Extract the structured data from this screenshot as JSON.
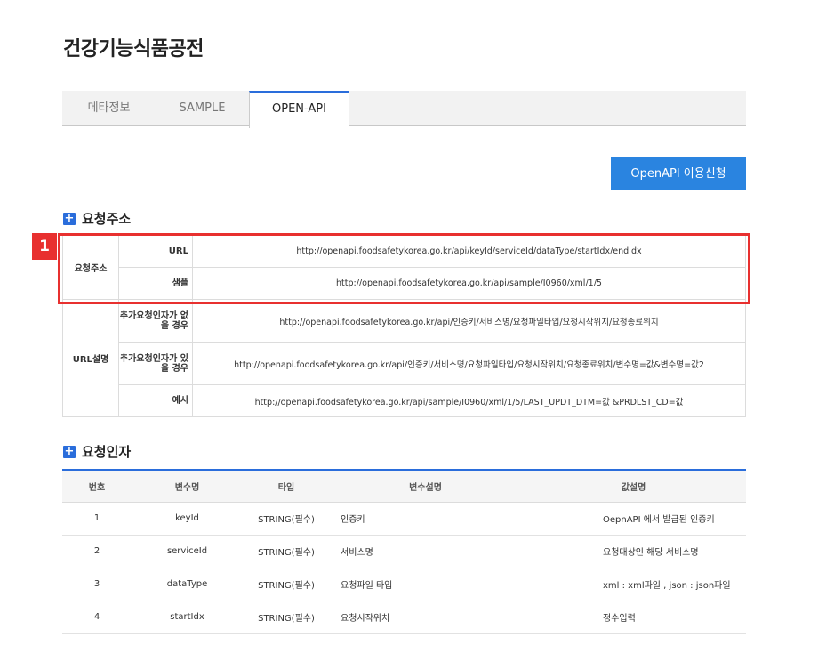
{
  "page": {
    "title": "건강기능식품공전"
  },
  "tabs": [
    {
      "label": "메타정보"
    },
    {
      "label": "SAMPLE"
    },
    {
      "label": "OPEN-API"
    }
  ],
  "apply_button": {
    "label": "OpenAPI 이용신청"
  },
  "marker": "1",
  "request_url_section": {
    "heading": "요청주소",
    "group_request": "요청주소",
    "group_url_desc": "URL설명",
    "rows": [
      {
        "label": "URL",
        "value": "http://openapi.foodsafetykorea.go.kr/api/keyId/serviceId/dataType/startIdx/endIdx"
      },
      {
        "label": "샘플",
        "value": "http://openapi.foodsafetykorea.go.kr/api/sample/I0960/xml/1/5"
      },
      {
        "label": "추가요청인자가 없을 경우",
        "value": "http://openapi.foodsafetykorea.go.kr/api/인증키/서비스명/요청파일타입/요청시작위치/요청종료위치"
      },
      {
        "label": "추가요청인자가 있을 경우",
        "value": "http://openapi.foodsafetykorea.go.kr/api/인증키/서비스명/요청파일타입/요청시작위치/요청종료위치/변수명=값&변수명=값2"
      },
      {
        "label": "예시",
        "value": "http://openapi.foodsafetykorea.go.kr/api/sample/I0960/xml/1/5/LAST_UPDT_DTM=값 &PRDLST_CD=값"
      }
    ]
  },
  "request_params_section": {
    "heading": "요청인자",
    "columns": [
      "번호",
      "변수명",
      "타입",
      "변수설명",
      "값설명"
    ],
    "rows": [
      [
        "1",
        "keyId",
        "STRING(필수)",
        "인증키",
        "OepnAPI 에서 발급된 인증키"
      ],
      [
        "2",
        "serviceId",
        "STRING(필수)",
        "서비스명",
        "요청대상인 해당 서비스명"
      ],
      [
        "3",
        "dataType",
        "STRING(필수)",
        "요청파일 타입",
        "xml : xml파일 , json : json파일"
      ],
      [
        "4",
        "startIdx",
        "STRING(필수)",
        "요청시작위치",
        "정수입력"
      ]
    ]
  }
}
